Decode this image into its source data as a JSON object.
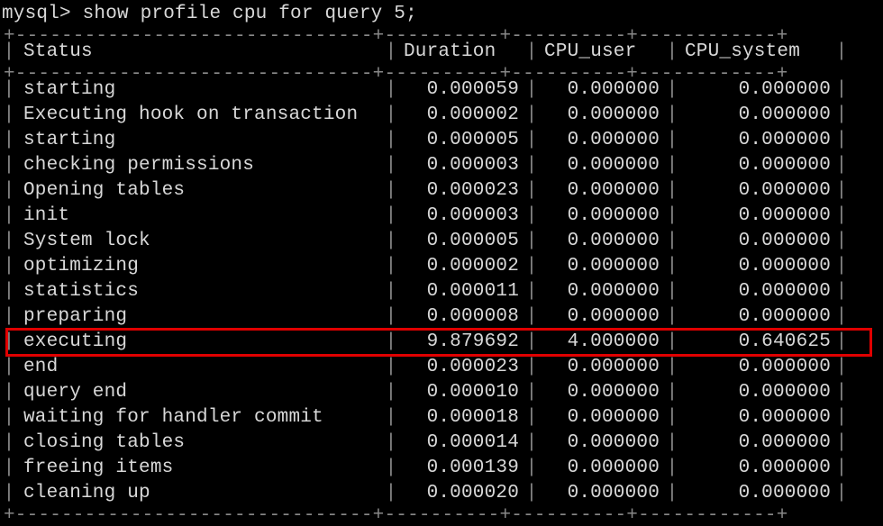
{
  "prompt": {
    "label": "mysql>",
    "command": "show profile cpu for query 5;"
  },
  "columns": {
    "status": "Status",
    "duration": "Duration",
    "cpu_user": "CPU_user",
    "cpu_system": "CPU_system"
  },
  "highlight_index": 10,
  "rows": [
    {
      "status": "starting",
      "duration": "0.000059",
      "cpu_user": "0.000000",
      "cpu_system": "0.000000"
    },
    {
      "status": "Executing hook on transaction",
      "duration": "0.000002",
      "cpu_user": "0.000000",
      "cpu_system": "0.000000"
    },
    {
      "status": "starting",
      "duration": "0.000005",
      "cpu_user": "0.000000",
      "cpu_system": "0.000000"
    },
    {
      "status": "checking permissions",
      "duration": "0.000003",
      "cpu_user": "0.000000",
      "cpu_system": "0.000000"
    },
    {
      "status": "Opening tables",
      "duration": "0.000023",
      "cpu_user": "0.000000",
      "cpu_system": "0.000000"
    },
    {
      "status": "init",
      "duration": "0.000003",
      "cpu_user": "0.000000",
      "cpu_system": "0.000000"
    },
    {
      "status": "System lock",
      "duration": "0.000005",
      "cpu_user": "0.000000",
      "cpu_system": "0.000000"
    },
    {
      "status": "optimizing",
      "duration": "0.000002",
      "cpu_user": "0.000000",
      "cpu_system": "0.000000"
    },
    {
      "status": "statistics",
      "duration": "0.000011",
      "cpu_user": "0.000000",
      "cpu_system": "0.000000"
    },
    {
      "status": "preparing",
      "duration": "0.000008",
      "cpu_user": "0.000000",
      "cpu_system": "0.000000"
    },
    {
      "status": "executing",
      "duration": "9.879692",
      "cpu_user": "4.000000",
      "cpu_system": "0.640625"
    },
    {
      "status": "end",
      "duration": "0.000023",
      "cpu_user": "0.000000",
      "cpu_system": "0.000000"
    },
    {
      "status": "query end",
      "duration": "0.000010",
      "cpu_user": "0.000000",
      "cpu_system": "0.000000"
    },
    {
      "status": "waiting for handler commit",
      "duration": "0.000018",
      "cpu_user": "0.000000",
      "cpu_system": "0.000000"
    },
    {
      "status": "closing tables",
      "duration": "0.000014",
      "cpu_user": "0.000000",
      "cpu_system": "0.000000"
    },
    {
      "status": "freeing items",
      "duration": "0.000139",
      "cpu_user": "0.000000",
      "cpu_system": "0.000000"
    },
    {
      "status": "cleaning up",
      "duration": "0.000020",
      "cpu_user": "0.000000",
      "cpu_system": "0.000000"
    }
  ],
  "border": {
    "corner": "+",
    "h": "-",
    "v": "|"
  }
}
